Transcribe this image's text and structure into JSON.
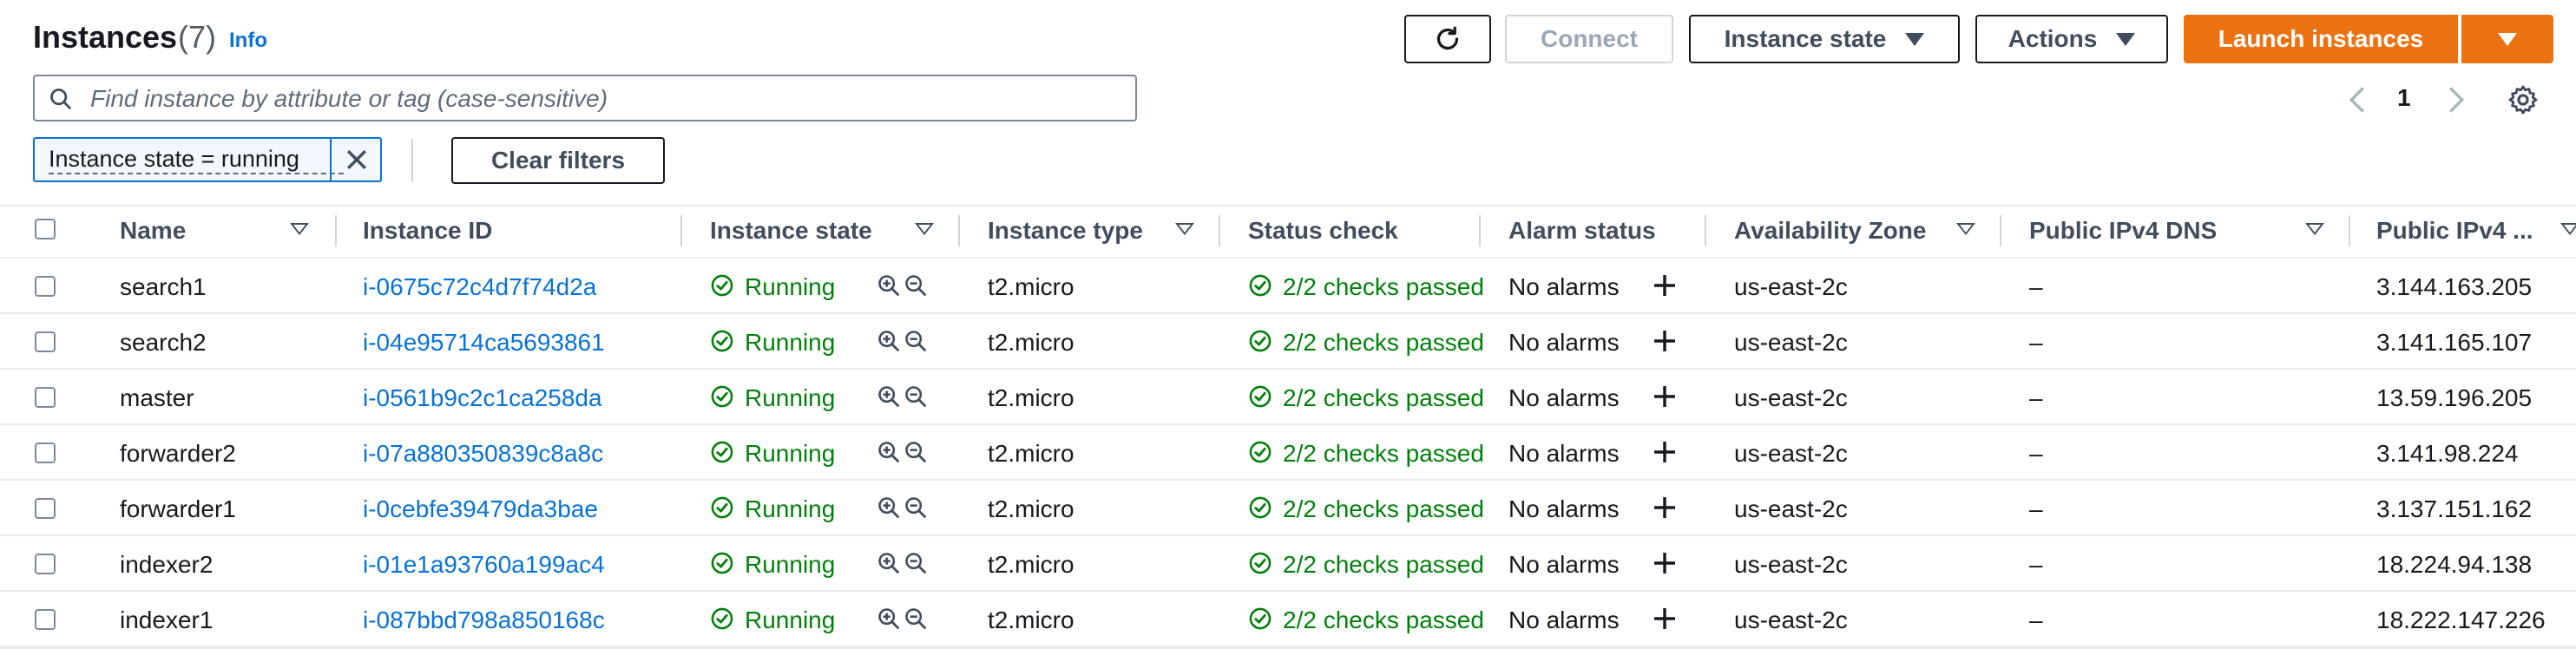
{
  "header": {
    "title": "Instances",
    "count": "(7)",
    "info": "Info",
    "connect_label": "Connect",
    "instance_state_label": "Instance state",
    "actions_label": "Actions",
    "launch_label": "Launch instances"
  },
  "search": {
    "placeholder": "Find instance by attribute or tag (case-sensitive)",
    "value": ""
  },
  "pagination": {
    "page": "1"
  },
  "filter": {
    "token": "Instance state = running",
    "clear_label": "Clear filters"
  },
  "columns": [
    "Name",
    "Instance ID",
    "Instance state",
    "Instance type",
    "Status check",
    "Alarm status",
    "Availability Zone",
    "Public IPv4 DNS",
    "Public IPv4 ..."
  ],
  "rows": [
    {
      "name": "search1",
      "id": "i-0675c72c4d7f74d2a",
      "state": "Running",
      "type": "t2.micro",
      "status": "2/2 checks passed",
      "alarm": "No alarms",
      "az": "us-east-2c",
      "dns": "–",
      "ip": "3.144.163.205"
    },
    {
      "name": "search2",
      "id": "i-04e95714ca5693861",
      "state": "Running",
      "type": "t2.micro",
      "status": "2/2 checks passed",
      "alarm": "No alarms",
      "az": "us-east-2c",
      "dns": "–",
      "ip": "3.141.165.107"
    },
    {
      "name": "master",
      "id": "i-0561b9c2c1ca258da",
      "state": "Running",
      "type": "t2.micro",
      "status": "2/2 checks passed",
      "alarm": "No alarms",
      "az": "us-east-2c",
      "dns": "–",
      "ip": "13.59.196.205"
    },
    {
      "name": "forwarder2",
      "id": "i-07a880350839c8a8c",
      "state": "Running",
      "type": "t2.micro",
      "status": "2/2 checks passed",
      "alarm": "No alarms",
      "az": "us-east-2c",
      "dns": "–",
      "ip": "3.141.98.224"
    },
    {
      "name": "forwarder1",
      "id": "i-0cebfe39479da3bae",
      "state": "Running",
      "type": "t2.micro",
      "status": "2/2 checks passed",
      "alarm": "No alarms",
      "az": "us-east-2c",
      "dns": "–",
      "ip": "3.137.151.162"
    },
    {
      "name": "indexer2",
      "id": "i-01e1a93760a199ac4",
      "state": "Running",
      "type": "t2.micro",
      "status": "2/2 checks passed",
      "alarm": "No alarms",
      "az": "us-east-2c",
      "dns": "–",
      "ip": "18.224.94.138"
    },
    {
      "name": "indexer1",
      "id": "i-087bbd798a850168c",
      "state": "Running",
      "type": "t2.micro",
      "status": "2/2 checks passed",
      "alarm": "No alarms",
      "az": "us-east-2c",
      "dns": "–",
      "ip": "18.222.147.226"
    }
  ],
  "colors": {
    "accent": "#ec7211",
    "link": "#0972d3",
    "success": "#037f0c",
    "border": "#16191f"
  },
  "icons": [
    "refresh-icon",
    "search-icon",
    "chevron-left-icon",
    "chevron-right-icon",
    "settings-icon",
    "close-icon",
    "check-circle-icon",
    "zoom-in-icon",
    "zoom-out-icon",
    "plus-icon",
    "sort-icon"
  ]
}
